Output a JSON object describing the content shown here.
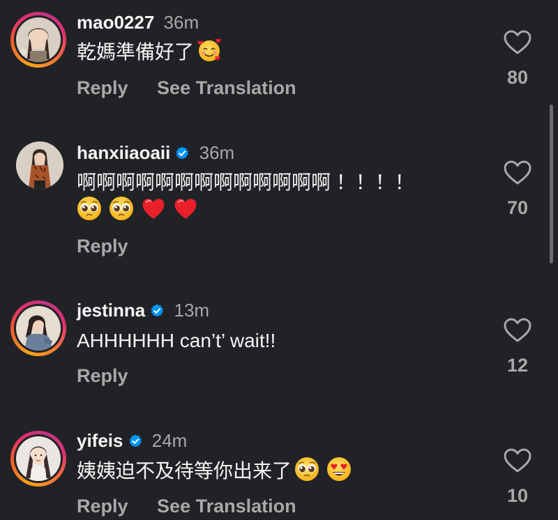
{
  "comments": [
    {
      "username": "mao0227",
      "verified": false,
      "time": "36m",
      "text": "乾媽準備好了",
      "emojis": [
        "smiling-face-with-hearts"
      ],
      "actions": {
        "reply": "Reply",
        "translate": "See Translation"
      },
      "likes": "80"
    },
    {
      "username": "hanxiiaoaii",
      "verified": true,
      "time": "36m",
      "text": "啊啊啊啊啊啊啊啊啊啊啊啊啊 ！！！！",
      "emojis": [
        "pleading-face",
        "pleading-face",
        "red-heart",
        "red-heart"
      ],
      "actions": {
        "reply": "Reply"
      },
      "likes": "70"
    },
    {
      "username": "jestinna",
      "verified": true,
      "time": "13m",
      "text": "AHHHHHH can’t’ wait!!",
      "emojis": [],
      "actions": {
        "reply": "Reply"
      },
      "likes": "12"
    },
    {
      "username": "yifeis",
      "verified": true,
      "time": "24m",
      "text": "姨姨迫不及待等你出来了",
      "emojis": [
        "pleading-face",
        "heart-eyes"
      ],
      "actions": {
        "reply": "Reply",
        "translate": "See Translation"
      },
      "likes": "10"
    }
  ],
  "colors": {
    "background": "#212226",
    "primary_text": "#f5f5f5",
    "secondary_text": "#a8a8a8",
    "verified_blue": "#0095f6"
  }
}
